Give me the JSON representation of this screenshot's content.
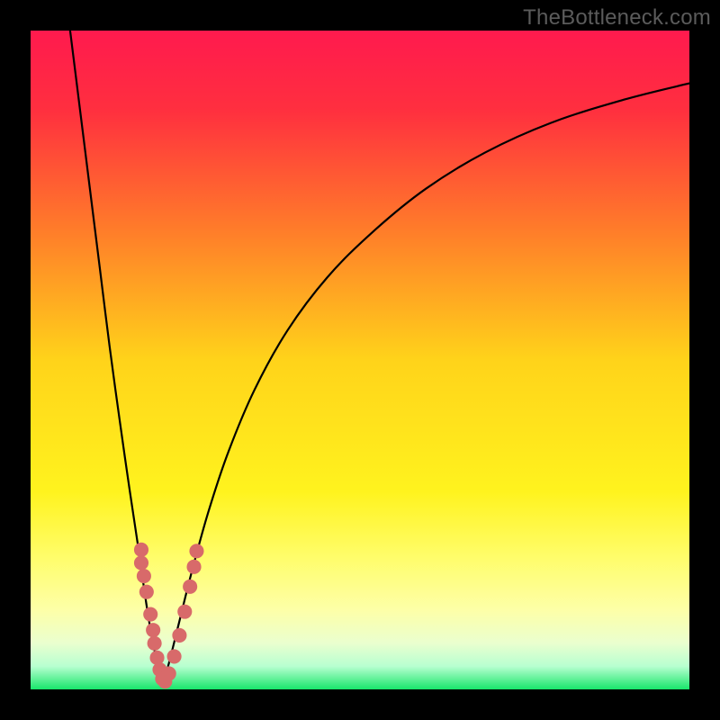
{
  "watermark": "TheBottleneck.com",
  "chart_data": {
    "type": "line",
    "title": "",
    "xlabel": "",
    "ylabel": "",
    "xlim": [
      0,
      1000
    ],
    "ylim": [
      0,
      1000
    ],
    "gradient_stops": [
      {
        "offset": 0.0,
        "color": "#ff1a4e"
      },
      {
        "offset": 0.12,
        "color": "#ff2f3f"
      },
      {
        "offset": 0.3,
        "color": "#ff7b2a"
      },
      {
        "offset": 0.5,
        "color": "#ffd31a"
      },
      {
        "offset": 0.7,
        "color": "#fff31e"
      },
      {
        "offset": 0.8,
        "color": "#fffd6b"
      },
      {
        "offset": 0.88,
        "color": "#fdffa8"
      },
      {
        "offset": 0.93,
        "color": "#eaffcf"
      },
      {
        "offset": 0.965,
        "color": "#b7ffd0"
      },
      {
        "offset": 1.0,
        "color": "#18e66b"
      }
    ],
    "series": [
      {
        "name": "left-branch",
        "x": [
          60,
          75,
          90,
          105,
          120,
          135,
          150,
          165,
          172,
          178,
          184,
          190,
          196,
          200
        ],
        "y": [
          1000,
          880,
          760,
          640,
          520,
          410,
          305,
          205,
          155,
          115,
          80,
          50,
          25,
          5
        ]
      },
      {
        "name": "right-branch",
        "x": [
          200,
          210,
          225,
          245,
          270,
          300,
          340,
          390,
          450,
          520,
          600,
          690,
          790,
          900,
          1000
        ],
        "y": [
          5,
          40,
          100,
          180,
          270,
          360,
          455,
          545,
          625,
          695,
          760,
          815,
          860,
          895,
          920
        ]
      }
    ],
    "markers": {
      "name": "highlight-points",
      "color": "#d86a6a",
      "r": 11,
      "points": [
        [
          168,
          212
        ],
        [
          168,
          192
        ],
        [
          172,
          172
        ],
        [
          176,
          148
        ],
        [
          182,
          114
        ],
        [
          186,
          90
        ],
        [
          188,
          70
        ],
        [
          192,
          48
        ],
        [
          196,
          30
        ],
        [
          200,
          16
        ],
        [
          204,
          12
        ],
        [
          210,
          24
        ],
        [
          218,
          50
        ],
        [
          226,
          82
        ],
        [
          234,
          118
        ],
        [
          242,
          156
        ],
        [
          248,
          186
        ],
        [
          252,
          210
        ]
      ]
    }
  }
}
